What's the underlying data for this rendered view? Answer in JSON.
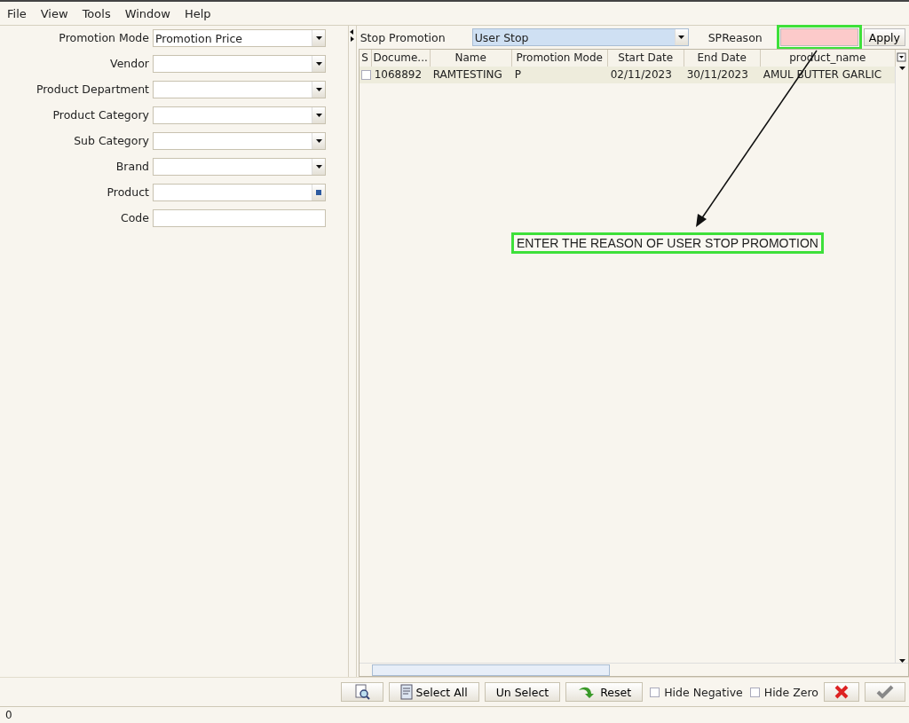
{
  "menu": [
    "File",
    "View",
    "Tools",
    "Window",
    "Help"
  ],
  "filters": [
    {
      "label": "Promotion Mode",
      "kind": "dropdown",
      "value": "Promotion Price"
    },
    {
      "label": "Vendor",
      "kind": "dropdown"
    },
    {
      "label": "Product Department",
      "kind": "dropdown"
    },
    {
      "label": "Product Category",
      "kind": "dropdown"
    },
    {
      "label": "Sub Category",
      "kind": "dropdown"
    },
    {
      "label": "Brand",
      "kind": "dropdown"
    },
    {
      "label": "Product",
      "kind": "lookup"
    },
    {
      "label": "Code",
      "kind": "text"
    }
  ],
  "stop_bar": {
    "label": "Stop Promotion",
    "value": "User Stop",
    "reason_label": "SPReason",
    "apply": "Apply"
  },
  "table": {
    "select_header": "S",
    "columns": [
      "Docume...",
      "Name",
      "Promotion Mode",
      "Start Date",
      "End Date",
      "product_name"
    ],
    "rows": [
      {
        "checked": false,
        "cells": [
          "1068892",
          "RAMTESTING",
          "P",
          "02/11/2023",
          "30/11/2023",
          "AMUL BUTTER GARLIC"
        ]
      }
    ]
  },
  "annotation": {
    "text": "ENTER THE REASON OF USER STOP PROMOTION"
  },
  "toolbar": {
    "buttons": [
      {
        "kind": "zoom"
      },
      {
        "kind": "select",
        "label": "Select All"
      },
      {
        "kind": "plain",
        "label": "Un Select"
      },
      {
        "kind": "reset",
        "label": "Reset"
      }
    ],
    "checks": [
      {
        "label": "Hide Negative",
        "checked": false
      },
      {
        "label": "Hide Zero",
        "checked": false
      }
    ]
  },
  "status_bar": {
    "text": "0"
  }
}
